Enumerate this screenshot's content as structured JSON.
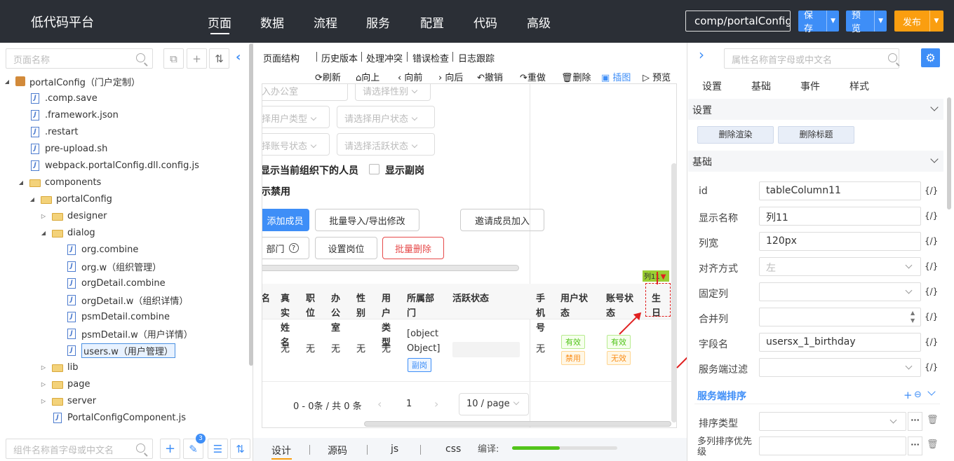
{
  "app": {
    "title": "低代码平台"
  },
  "nav": {
    "items": [
      "页面",
      "数据",
      "流程",
      "服务",
      "配置",
      "代码",
      "高级"
    ],
    "active": "页面"
  },
  "header": {
    "comp_path": "comp/portalConfig",
    "save": "保存",
    "preview": "预览",
    "publish": "发布"
  },
  "colors": {
    "topbar": "#2b2f36",
    "accent": "#3e8ef7",
    "publish": "#fa9e10",
    "danger": "#e64a4a",
    "success": "#52c41a"
  },
  "left": {
    "search_placeholder": "页面名称",
    "bottom_search_placeholder": "组件名称首字母或中文名",
    "wrench_badge": "3",
    "tree": [
      {
        "label": "portalConfig（门户定制）",
        "depth": 0,
        "type": "pkg",
        "arrow": "down"
      },
      {
        "label": ".comp.save",
        "depth": 1,
        "type": "file"
      },
      {
        "label": ".framework.json",
        "depth": 1,
        "type": "file"
      },
      {
        "label": ".restart",
        "depth": 1,
        "type": "file"
      },
      {
        "label": "pre-upload.sh",
        "depth": 1,
        "type": "file"
      },
      {
        "label": "webpack.portalConfig.dll.config.js",
        "depth": 1,
        "type": "file"
      },
      {
        "label": "components",
        "depth": 1,
        "type": "folder",
        "arrow": "down"
      },
      {
        "label": "portalConfig",
        "depth": 2,
        "type": "folder",
        "arrow": "down"
      },
      {
        "label": "designer",
        "depth": 3,
        "type": "folder",
        "arrow": "right"
      },
      {
        "label": "dialog",
        "depth": 3,
        "type": "folder",
        "arrow": "down"
      },
      {
        "label": "org.combine",
        "depth": 4,
        "type": "file"
      },
      {
        "label": "org.w（组织管理）",
        "depth": 4,
        "type": "file"
      },
      {
        "label": "orgDetail.combine",
        "depth": 4,
        "type": "file"
      },
      {
        "label": "orgDetail.w（组织详情）",
        "depth": 4,
        "type": "file"
      },
      {
        "label": "psmDetail.combine",
        "depth": 4,
        "type": "file"
      },
      {
        "label": "psmDetail.w（用户详情）",
        "depth": 4,
        "type": "file"
      },
      {
        "label": "users.w（用户管理）",
        "depth": 4,
        "type": "file",
        "selected": true
      },
      {
        "label": "lib",
        "depth": 3,
        "type": "folder",
        "arrow": "right"
      },
      {
        "label": "page",
        "depth": 3,
        "type": "folder",
        "arrow": "right"
      },
      {
        "label": "server",
        "depth": 3,
        "type": "folder",
        "arrow": "right"
      },
      {
        "label": "PortalConfigComponent.js",
        "depth": 3,
        "type": "file"
      }
    ]
  },
  "center": {
    "toolbar": [
      "页面结构",
      "历史版本",
      "处理冲突",
      "错误检查",
      "日志跟踪"
    ],
    "actions": {
      "refresh": "刷新",
      "up": "向上",
      "prev": "向前",
      "next": "向后",
      "undo": "撤销",
      "redo": "重做",
      "delete": "删除",
      "insert": "插图",
      "preview": "预览"
    },
    "form": {
      "sel_office": "入办公室",
      "sel_gender": "请选择性别",
      "sel_user_type": "择用户类型",
      "sel_user_status": "请选择用户状态",
      "sel_account_status": "择账号状态",
      "sel_active_status": "请选择活跃状态",
      "show_current_org": "显示当前组织下的人员",
      "show_deputy": "显示副岗",
      "show_disabled": "示禁用"
    },
    "buttons": {
      "add_member": "添加成员",
      "batch_import": "批量导入/导出修改",
      "invite": "邀请成员加入",
      "dept": "部门",
      "set_post": "设置岗位",
      "batch_delete": "批量删除"
    },
    "table": {
      "headers": [
        "名",
        "真实姓名",
        "职位",
        "办公室",
        "性别",
        "用户类型",
        "所属部门",
        "活跃状态",
        "手机号",
        "用户状态",
        "账号状态",
        "生日"
      ],
      "row": {
        "realname": "无",
        "position": "无",
        "office": "无",
        "gender": "无",
        "usertype": "无",
        "dept": "[object Object]",
        "dept_tag": "副岗",
        "phone": "无",
        "user_status": [
          "有效",
          "禁用"
        ],
        "account_status": [
          "有效",
          "无效"
        ]
      },
      "col_tag": "列11"
    },
    "pagination": {
      "summary": "0 - 0条 / 共 0 条",
      "page": "1",
      "page_size": "10 / page"
    },
    "bottom_tabs": [
      "设计",
      "源码",
      "js",
      "css"
    ],
    "compile_label": "编译:",
    "compile_progress": 0.45
  },
  "right": {
    "search_placeholder": "属性名称首字母或中文名",
    "tabs": [
      "设置",
      "基础",
      "事件",
      "样式"
    ],
    "section_settings": "设置",
    "btn_delete_render": "删除渲染",
    "btn_delete_title": "删除标题",
    "section_basic": "基础",
    "fields": {
      "id_label": "id",
      "id_value": "tableColumn11",
      "name_label": "显示名称",
      "name_value": "列11",
      "width_label": "列宽",
      "width_value": "120px",
      "align_label": "对齐方式",
      "align_value": "左",
      "fixed_label": "固定列",
      "fixed_value": "",
      "merge_label": "合并列",
      "merge_value": "",
      "field_label": "字段名",
      "field_value": "usersx_1_birthday",
      "filter_label": "服务端过滤",
      "filter_value": ""
    },
    "fx": "{/}",
    "section_sort": "服务端排序",
    "sort_type_label": "排序类型",
    "sort_priority_label": "多列排序优先级"
  }
}
